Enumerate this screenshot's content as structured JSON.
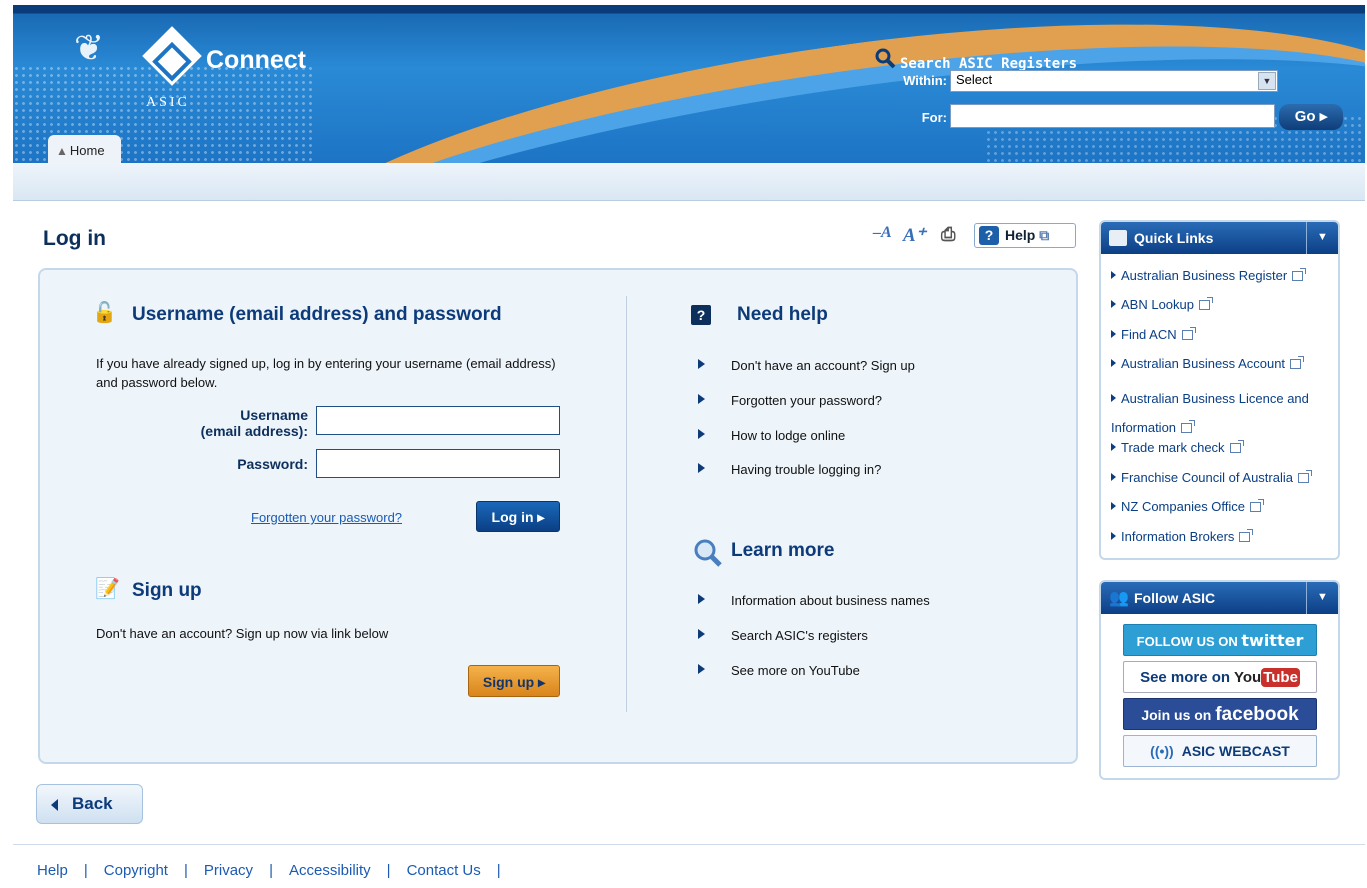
{
  "header": {
    "logo_text": "Connect",
    "org_text": "ASIC",
    "home_tab": "Home",
    "search": {
      "title": "Search ASIC Registers",
      "within_label": "Within:",
      "within_value": "Select",
      "for_label": "For:",
      "for_value": "",
      "go_label": "Go"
    }
  },
  "page_title": "Log in",
  "tools": {
    "help_label": "Help"
  },
  "login": {
    "title": "Username (email address) and password",
    "intro": "If you have already signed up, log in by entering your username (email address) and password below.",
    "username_label_1": "Username",
    "username_label_2": "(email address):",
    "username_value": "",
    "password_label": "Password:",
    "password_value": "",
    "forgot_link": "Forgotten your password?",
    "login_button": "Log in"
  },
  "signup": {
    "title": "Sign up",
    "text": "Don't have an account? Sign up now via link below",
    "button": "Sign up"
  },
  "need_help": {
    "title": "Need help",
    "items": [
      "Don't have an account? Sign up",
      "Forgotten your password?",
      "How to lodge online",
      "Having trouble logging in?"
    ]
  },
  "learn_more": {
    "title": "Learn more",
    "items": [
      "Information about business names",
      "Search ASIC's registers",
      "See more on YouTube"
    ]
  },
  "quick_links": {
    "title": "Quick Links",
    "items": [
      "Australian Business Register",
      "ABN Lookup",
      "Find ACN",
      "Australian Business Account",
      "Australian Business Licence and",
      "Information",
      "Trade mark check",
      "Franchise Council of Australia",
      "NZ Companies Office",
      "Information Brokers"
    ]
  },
  "follow": {
    "title": "Follow ASIC",
    "twitter_a": "FOLLOW US ON",
    "twitter_b": "twitter",
    "youtube_a": "See more on",
    "youtube_b": "You",
    "youtube_c": "Tube",
    "facebook_a": "Join us on",
    "facebook_b": "facebook",
    "webcast": "ASIC WEBCAST"
  },
  "back_label": "Back",
  "footer": [
    "Help",
    "Copyright",
    "Privacy",
    "Accessibility",
    "Contact Us"
  ],
  "colors": {
    "brand_blue": "#0d3b7a",
    "accent_orange": "#e09a33",
    "link": "#1b5bb3"
  }
}
